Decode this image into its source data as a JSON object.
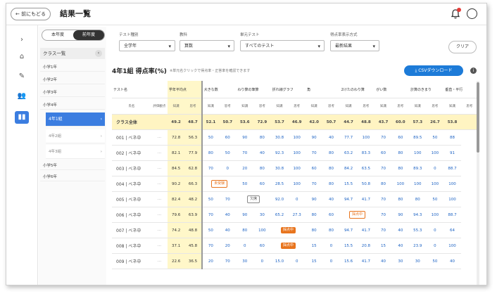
{
  "topbar": {
    "back_label": "← 前にもどる",
    "title": "結果一覧"
  },
  "rail": {
    "collapse": "›",
    "home": "⌂",
    "edit": "✎",
    "users": "👥",
    "chart": "▮▮"
  },
  "sidebar": {
    "tabs": [
      "本年度",
      "前年度"
    ],
    "class_list_label": "クラス一覧",
    "items": [
      {
        "label": "小学1年",
        "kind": "group"
      },
      {
        "label": "小学2年",
        "kind": "group"
      },
      {
        "label": "小学3年",
        "kind": "group"
      },
      {
        "label": "小学4年",
        "kind": "group"
      },
      {
        "label": "4年1組",
        "kind": "selected"
      },
      {
        "label": "4年2組",
        "kind": "sub"
      },
      {
        "label": "4年3組",
        "kind": "sub"
      },
      {
        "label": "小学5年",
        "kind": "group"
      },
      {
        "label": "小学6年",
        "kind": "group"
      }
    ]
  },
  "filters": {
    "test_type": {
      "label": "テスト種別",
      "value": "全学年"
    },
    "subject": {
      "label": "教科",
      "value": "算数"
    },
    "unit_test": {
      "label": "単元テスト",
      "value": "すべてのテスト"
    },
    "display_mode": {
      "label": "得点率表示方式",
      "value": "最新結果"
    },
    "clear_label": "クリア"
  },
  "results": {
    "title": "4年1組 得点率(%)",
    "note": "※単元名クリックで得点率・正答率を確認できます",
    "csv_label": "CSVダウンロード",
    "info": "i"
  },
  "table": {
    "test_col_label": "テスト名",
    "name_col_label": "氏名",
    "eval_label": "評価観点",
    "columns": [
      "学年平均点",
      "大きな数",
      "わり算の筆算",
      "折れ線グラフ",
      "角",
      "2けたのわり算",
      "がい数",
      "計算のきまり",
      "垂直・平行"
    ],
    "subheaders": [
      "知識",
      "思考"
    ],
    "total_label": "クラス全体",
    "total_values": [
      "49.2",
      "48.7",
      "52.1",
      "50.7",
      "53.6",
      "72.9",
      "53.7",
      "46.9",
      "42.0",
      "50.7",
      "44.7",
      "48.8",
      "43.7",
      "60.0",
      "57.3",
      "26.7",
      "53.8"
    ],
    "rows": [
      {
        "name": "001 | ベネ中",
        "values": [
          "72.8",
          "56.3",
          "50",
          "60",
          "90",
          "80",
          "30.8",
          "100",
          "90",
          "40",
          "77.7",
          "100",
          "70",
          "60",
          "89.5",
          "50",
          "88"
        ]
      },
      {
        "name": "002 | ベネ中",
        "values": [
          "82.1",
          "77.9",
          "80",
          "50",
          "70",
          "40",
          "92.3",
          "100",
          "70",
          "80",
          "63.2",
          "83.3",
          "60",
          "80",
          "100",
          "100",
          "91"
        ]
      },
      {
        "name": "003 | ベネ中",
        "values": [
          "84.5",
          "62.8",
          "70",
          "0",
          "20",
          "80",
          "30.8",
          "100",
          "60",
          "80",
          "84.2",
          "63.5",
          "70",
          "80",
          "89.3",
          "0",
          "88.7"
        ]
      },
      {
        "name": "004 | ベネ中",
        "values": [
          "90.2",
          "66.3",
          "",
          "",
          "50",
          "60",
          "28.5",
          "100",
          "70",
          "80",
          "15.5",
          "50.8",
          "80",
          "100",
          "100",
          "100",
          "100"
        ]
      },
      {
        "name": "005 | ベネ中",
        "values": [
          "82.4",
          "48.2",
          "50",
          "70",
          "",
          "",
          "92.0",
          "0",
          "90",
          "40",
          "94.7",
          "41.7",
          "70",
          "80",
          "80",
          "50",
          "100"
        ]
      },
      {
        "name": "006 | ベネ中",
        "values": [
          "79.6",
          "63.9",
          "70",
          "40",
          "90",
          "30",
          "65.2",
          "27.3",
          "80",
          "60",
          "",
          "",
          "70",
          "90",
          "94.3",
          "100",
          "88.7"
        ]
      },
      {
        "name": "007 | ベネ中",
        "values": [
          "74.2",
          "48.8",
          "50",
          "40",
          "80",
          "100",
          "",
          "",
          "80",
          "80",
          "94.7",
          "41.7",
          "70",
          "40",
          "55.3",
          "0",
          "64"
        ]
      },
      {
        "name": "008 | ベネ中",
        "values": [
          "37.1",
          "45.8",
          "70",
          "20",
          "0",
          "60",
          "",
          "",
          "15",
          "0",
          "15.5",
          "20.8",
          "15",
          "40",
          "23.9",
          "0",
          "100"
        ]
      },
      {
        "name": "009 | ベネ中",
        "values": [
          "22.6",
          "36.5",
          "20",
          "70",
          "30",
          "0",
          "15.0",
          "0",
          "15",
          "0",
          "15.6",
          "41.7",
          "40",
          "30",
          "30",
          "50",
          "40"
        ]
      }
    ],
    "badges": {
      "not_taken": "未受験",
      "absent": "欠席",
      "in_progress": "採点中",
      "pending": "採点中"
    }
  }
}
